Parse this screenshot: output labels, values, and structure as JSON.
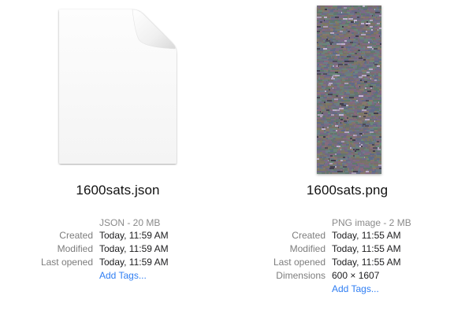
{
  "items": [
    {
      "filename": "1600sats.json",
      "kind": "JSON - 20 MB",
      "icon": "generic-document-icon",
      "details": [
        {
          "label": "Created",
          "value": "Today, 11:59 AM"
        },
        {
          "label": "Modified",
          "value": "Today, 11:59 AM"
        },
        {
          "label": "Last opened",
          "value": "Today, 11:59 AM"
        }
      ],
      "add_tags": "Add Tags..."
    },
    {
      "filename": "1600sats.png",
      "kind": "PNG image - 2 MB",
      "icon": "image-thumbnail",
      "details": [
        {
          "label": "Created",
          "value": "Today, 11:55 AM"
        },
        {
          "label": "Modified",
          "value": "Today, 11:55 AM"
        },
        {
          "label": "Last opened",
          "value": "Today, 11:55 AM"
        },
        {
          "label": "Dimensions",
          "value": "600 × 1607"
        }
      ],
      "add_tags": "Add Tags..."
    }
  ],
  "colors": {
    "link": "#2f7ef3",
    "label": "#7d7d7d",
    "value": "#1d1d1f"
  }
}
